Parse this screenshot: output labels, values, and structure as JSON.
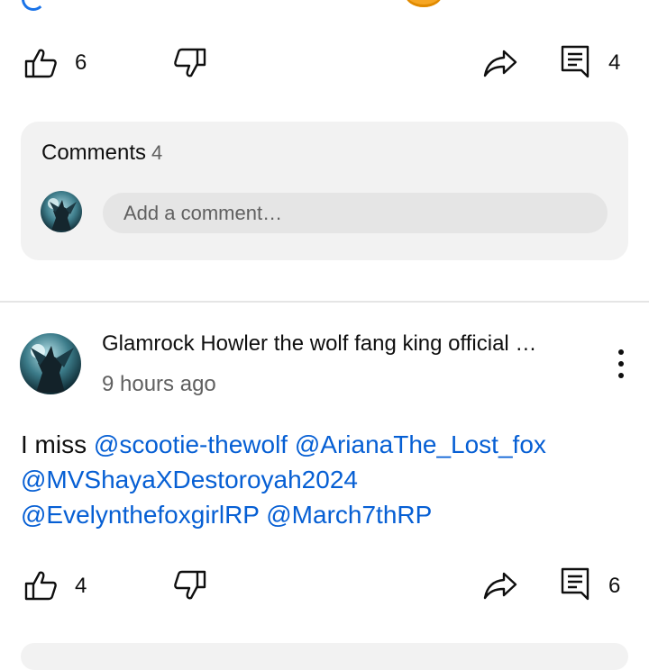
{
  "post_actions": {
    "like_count": "6",
    "comment_count": "4"
  },
  "comments_section": {
    "title": "Comments",
    "count": "4",
    "add_comment_placeholder": "Add a comment…"
  },
  "comment": {
    "author": "Glamrock Howler the wolf fang king official …",
    "time": "9 hours ago",
    "text_prefix": "I miss ",
    "mentions": [
      "@scootie-thewolf",
      "@ArianaThe_Lost_fox",
      "@MVShayaXDestoroyah2024",
      "@EvelynthefoxgirlRP",
      "@March7thRP"
    ],
    "like_count": "4",
    "reply_count": "6"
  },
  "colors": {
    "mention": "#065fd4",
    "card_bg": "#f2f2f2",
    "secondary_text": "#606060"
  },
  "icons": [
    "thumb-up-icon",
    "thumb-down-icon",
    "share-icon",
    "comment-icon",
    "more-vert-icon"
  ]
}
